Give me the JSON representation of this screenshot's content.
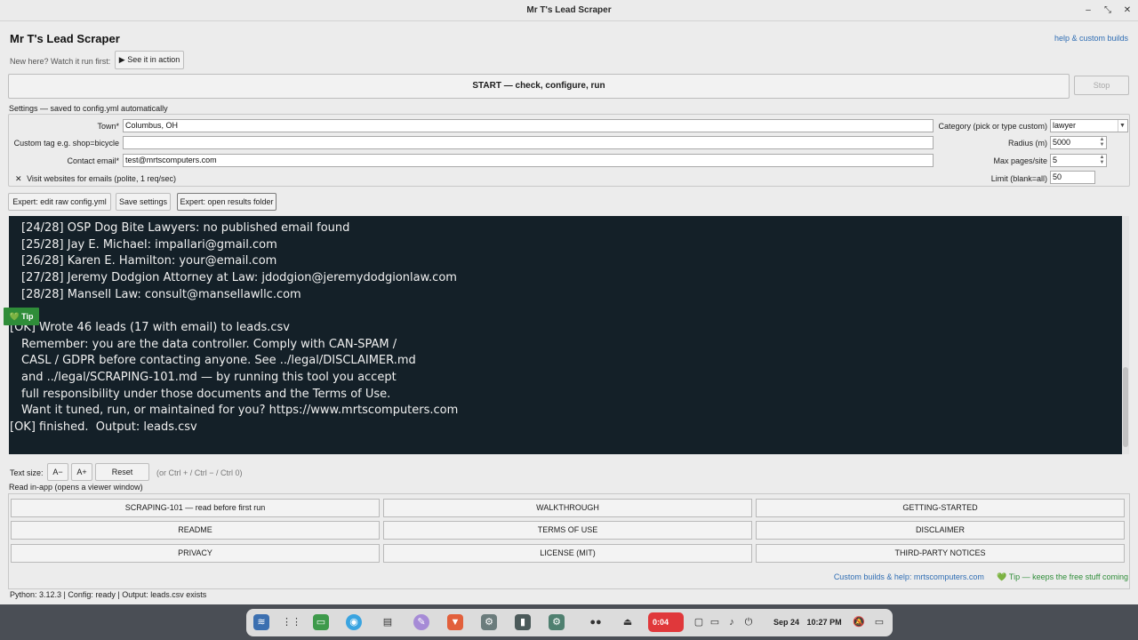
{
  "window": {
    "title": "Mr T's Lead Scraper"
  },
  "header": {
    "app_title": "Mr T's Lead Scraper",
    "help_link": "help & custom builds",
    "new_here": "New here? Watch it run first:",
    "see_it": "▶ See it in action"
  },
  "controls": {
    "start_label": "START — check, configure, run",
    "stop_label": "Stop"
  },
  "settings": {
    "section_label": "Settings — saved to config.yml automatically",
    "town_label": "Town*",
    "town_value": "Columbus, OH",
    "custom_tag_label": "Custom tag e.g. shop=bicycle",
    "custom_tag_value": "",
    "email_label": "Contact email*",
    "email_value": "test@mrtscomputers.com",
    "visit_checkbox_label": "Visit websites for emails (polite, 1 req/sec)",
    "visit_checked": true,
    "category_label": "Category (pick or type custom)",
    "category_value": "lawyer",
    "radius_label": "Radius (m)",
    "radius_value": "5000",
    "maxpages_label": "Max pages/site",
    "maxpages_value": "5",
    "limit_label": "Limit (blank=all)",
    "limit_value": "50"
  },
  "actions": {
    "edit_config": "Expert: edit raw config.yml",
    "save_settings": "Save settings",
    "open_results": "Expert: open results folder"
  },
  "log": {
    "lines": [
      {
        "text": "[24/28] OSP Dog Bite Lawyers: no published email found",
        "indent": true
      },
      {
        "text": "[25/28] Jay E. Michael: impallari@gmail.com",
        "indent": true
      },
      {
        "text": "[26/28] Karen E. Hamilton: your@email.com",
        "indent": true
      },
      {
        "text": "[27/28] Jeremy Dodgion Attorney at Law: jdodgion@jeremydodgionlaw.com",
        "indent": true
      },
      {
        "text": "[28/28] Mansell Law: consult@mansellawllc.com",
        "indent": true
      },
      {
        "text": "[OK] Wrote 46 leads (17 with email) to leads.csv",
        "indent": false
      },
      {
        "text": "Remember: you are the data controller. Comply with CAN-SPAM /",
        "indent": true
      },
      {
        "text": "CASL / GDPR before contacting anyone. See ../legal/DISCLAIMER.md",
        "indent": true
      },
      {
        "text": "and ../legal/SCRAPING-101.md — by running this tool you accept",
        "indent": true
      },
      {
        "text": "full responsibility under those documents and the Terms of Use.",
        "indent": true
      },
      {
        "text": "Want it tuned, run, or maintained for you? https://www.mrtscomputers.com",
        "indent": true
      },
      {
        "text": "[OK] finished.  Output: leads.csv",
        "indent": false
      }
    ],
    "tip_badge": "💚 Tip"
  },
  "textsize": {
    "label": "Text size:",
    "decrease": "A−",
    "increase": "A+",
    "reset": "Reset",
    "hint": "(or Ctrl + / Ctrl − / Ctrl 0)"
  },
  "docs": {
    "label": "Read in-app (opens a viewer window)",
    "buttons": [
      "SCRAPING-101 — read before first run",
      "WALKTHROUGH",
      "GETTING-STARTED",
      "README",
      "TERMS OF USE",
      "DISCLAIMER",
      "PRIVACY",
      "LICENSE (MIT)",
      "THIRD-PARTY NOTICES"
    ]
  },
  "footer": {
    "custom_builds": "Custom builds & help: mrtscomputers.com",
    "tip": "💚 Tip — keeps the free stuff coming",
    "status": "Python: 3.12.3 | Config: ready | Output: leads.csv exists"
  },
  "taskbar": {
    "timer": "0:04",
    "date": "Sep 24",
    "time": "10:27 PM"
  },
  "colors": {
    "log_bg": "#142028",
    "link": "#2f6db3",
    "tip_green": "#2f8d39",
    "timer_red": "#e0383b"
  }
}
